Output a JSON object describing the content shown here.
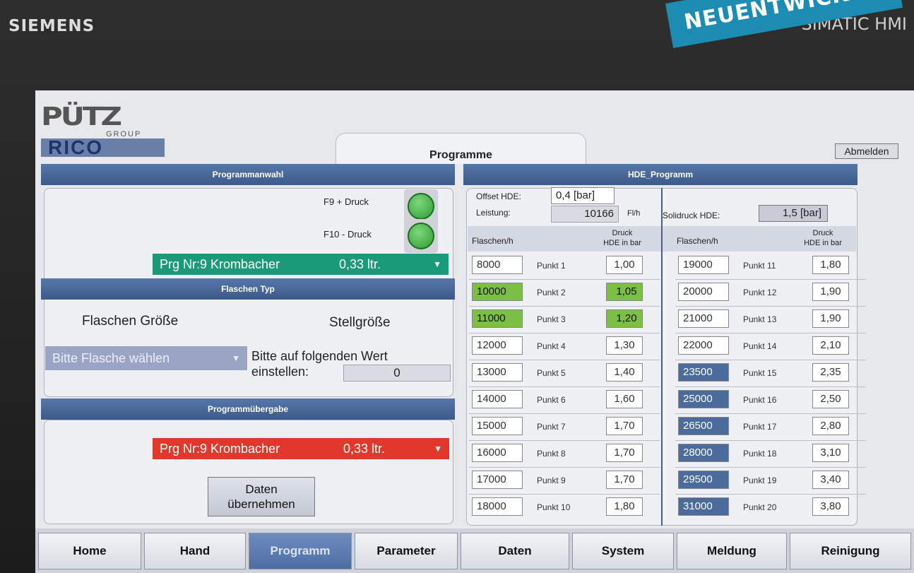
{
  "device": {
    "brand": "SIEMENS",
    "model": "SIMATIC HMI"
  },
  "banner": "NEUENTWICKLUNG",
  "logo": {
    "top": "PÜTZ",
    "group": "GROUP",
    "bottom": "RICO"
  },
  "page_title": "Programme",
  "logout_label": "Abmelden",
  "programmanwahl": {
    "header": "Programmanwahl",
    "f9_label": "F9 + Druck",
    "f10_label": "F10 - Druck",
    "selected_program": "Prg Nr:9 Krombacher",
    "selected_volume": "0,33 ltr.",
    "color": "#1a9a78"
  },
  "flaschen_typ": {
    "header": "Flaschen Typ",
    "size_label": "Flaschen Größe",
    "setting_label": "Stellgröße",
    "bottle_select": "Bitte Flasche wählen",
    "instruction_line1": "Bitte auf folgenden Wert",
    "instruction_line2": "einstellen:",
    "value": "0"
  },
  "programmuebergabe": {
    "header": "Programmübergabe",
    "selected_program": "Prg Nr:9 Krombacher",
    "selected_volume": "0,33 ltr.",
    "color": "#e0382c",
    "apply_line1": "Daten",
    "apply_line2": "übernehmen"
  },
  "hde": {
    "header": "HDE_Programm",
    "offset_label": "Offset HDE:",
    "offset_value": "0,4 [bar]",
    "power_label": "Leistung:",
    "power_value": "10166",
    "power_unit": "Fl/h",
    "solid_label": "Solidruck HDE:",
    "solid_value": "1,5 [bar]",
    "col_bottles": "Flaschen/h",
    "col_pressure_1": "Druck",
    "col_pressure_2": "HDE in bar",
    "left_rows": [
      {
        "bottles": "8000",
        "point": "Punkt 1",
        "pressure": "1,00",
        "bhl": "",
        "phl": ""
      },
      {
        "bottles": "10000",
        "point": "Punkt 2",
        "pressure": "1,05",
        "bhl": "g",
        "phl": "g"
      },
      {
        "bottles": "11000",
        "point": "Punkt 3",
        "pressure": "1,20",
        "bhl": "g",
        "phl": "g"
      },
      {
        "bottles": "12000",
        "point": "Punkt 4",
        "pressure": "1,30",
        "bhl": "",
        "phl": ""
      },
      {
        "bottles": "13000",
        "point": "Punkt 5",
        "pressure": "1,40",
        "bhl": "",
        "phl": ""
      },
      {
        "bottles": "14000",
        "point": "Punkt 6",
        "pressure": "1,60",
        "bhl": "",
        "phl": ""
      },
      {
        "bottles": "15000",
        "point": "Punkt 7",
        "pressure": "1,70",
        "bhl": "",
        "phl": ""
      },
      {
        "bottles": "16000",
        "point": "Punkt 8",
        "pressure": "1,70",
        "bhl": "",
        "phl": ""
      },
      {
        "bottles": "17000",
        "point": "Punkt 9",
        "pressure": "1,70",
        "bhl": "",
        "phl": ""
      },
      {
        "bottles": "18000",
        "point": "Punkt 10",
        "pressure": "1,80",
        "bhl": "",
        "phl": ""
      }
    ],
    "right_rows": [
      {
        "bottles": "19000",
        "point": "Punkt 11",
        "pressure": "1,80",
        "bhl": "",
        "phl": ""
      },
      {
        "bottles": "20000",
        "point": "Punkt 12",
        "pressure": "1,90",
        "bhl": "",
        "phl": ""
      },
      {
        "bottles": "21000",
        "point": "Punkt 13",
        "pressure": "1,90",
        "bhl": "",
        "phl": ""
      },
      {
        "bottles": "22000",
        "point": "Punkt 14",
        "pressure": "2,10",
        "bhl": "",
        "phl": ""
      },
      {
        "bottles": "23500",
        "point": "Punkt 15",
        "pressure": "2,35",
        "bhl": "b",
        "phl": ""
      },
      {
        "bottles": "25000",
        "point": "Punkt 16",
        "pressure": "2,50",
        "bhl": "b",
        "phl": ""
      },
      {
        "bottles": "26500",
        "point": "Punkt 17",
        "pressure": "2,80",
        "bhl": "b",
        "phl": ""
      },
      {
        "bottles": "28000",
        "point": "Punkt 18",
        "pressure": "3,10",
        "bhl": "b",
        "phl": ""
      },
      {
        "bottles": "29500",
        "point": "Punkt 19",
        "pressure": "3,40",
        "bhl": "b",
        "phl": ""
      },
      {
        "bottles": "31000",
        "point": "Punkt 20",
        "pressure": "3,80",
        "bhl": "b",
        "phl": ""
      }
    ]
  },
  "nav": [
    {
      "label": "Home",
      "active": false
    },
    {
      "label": "Hand",
      "active": false
    },
    {
      "label": "Programm",
      "active": true
    },
    {
      "label": "Parameter",
      "active": false
    },
    {
      "label": "Daten",
      "active": false
    },
    {
      "label": "System",
      "active": false
    },
    {
      "label": "Meldung",
      "active": false
    },
    {
      "label": "Reinigung",
      "active": false
    }
  ]
}
